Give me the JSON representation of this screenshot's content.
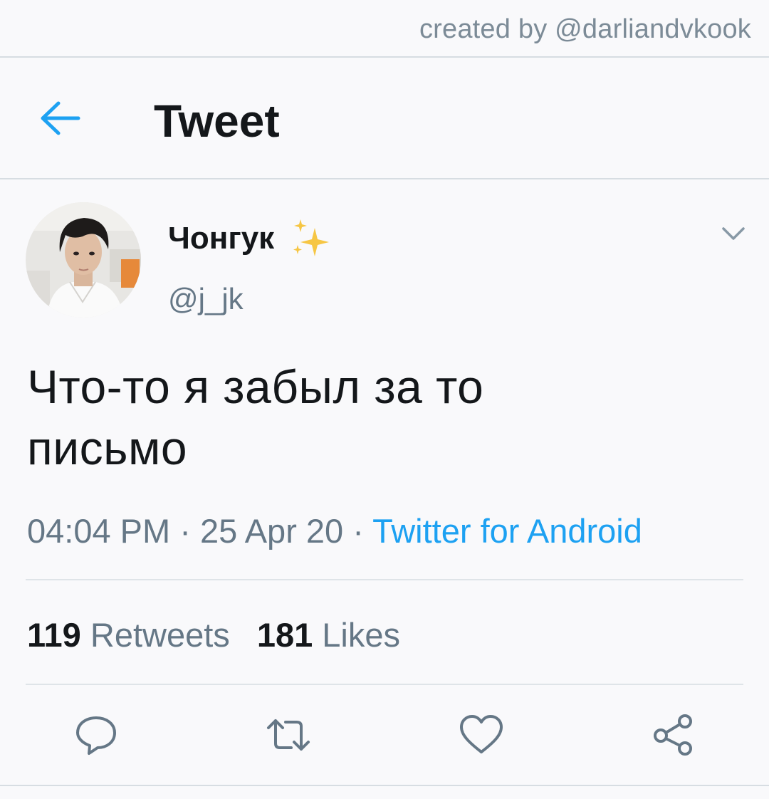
{
  "credit": {
    "text": "created by @darliandvkook"
  },
  "header": {
    "back_icon": "arrow-left-icon",
    "title": "Tweet"
  },
  "tweet": {
    "author": {
      "display_name": "Чонгук",
      "handle": "@j_jk",
      "emoji": "sparkles"
    },
    "text_line1": "Что-то я забыл за то",
    "text_line2": "письмо",
    "time": "04:04 PM",
    "separator": " · ",
    "date": "25 Apr 20",
    "source": "Twitter for Android"
  },
  "stats": {
    "retweets_count": "119",
    "retweets_label": "Retweets",
    "likes_count": "181",
    "likes_label": "Likes"
  },
  "actions": [
    {
      "icon": "reply-icon"
    },
    {
      "icon": "retweet-icon"
    },
    {
      "icon": "like-icon"
    },
    {
      "icon": "share-icon"
    }
  ],
  "colors": {
    "accent": "#1da1f2",
    "text_primary": "#14171a",
    "text_secondary": "#657786",
    "divider": "#dfe4e8"
  }
}
